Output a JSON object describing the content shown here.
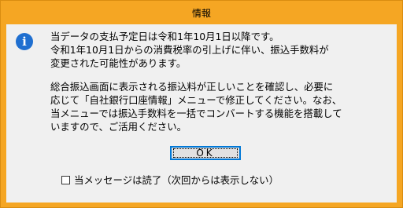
{
  "window": {
    "title": "情報"
  },
  "icon": {
    "name": "info-icon",
    "glyph": "i",
    "color": "#1f6fd0"
  },
  "message": {
    "paragraph1": "当データの支払予定日は令和1年10月1日以降です。\n令和1年10月1日からの消費税率の引上げに伴い、振込手数料が\n変更された可能性があります。",
    "paragraph2": "総合振込画面に表示される振込料が正しいことを確認し、必要に\n応じて「自社銀行口座情報」メニューで修正してください。なお、\n当メニューでは振込手数料を一括でコンバートする機能を搭載して\nいますので、ご活用ください。"
  },
  "buttons": {
    "ok_label": "OK"
  },
  "checkbox": {
    "label": "当メッセージは読了（次回からは表示しない）",
    "checked": false
  },
  "colors": {
    "frame": "#f5a623",
    "client": "#f0f0f0",
    "focus_border": "#0078d7"
  }
}
